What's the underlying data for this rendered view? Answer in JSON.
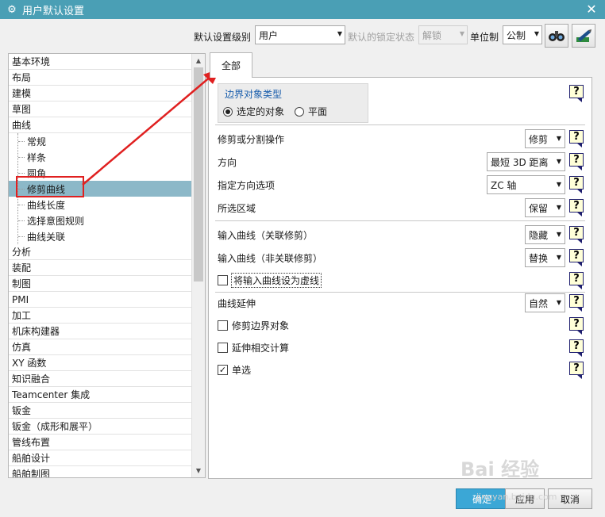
{
  "window": {
    "title": "用户默认设置",
    "close_glyph": "✕",
    "gear_glyph": "⚙"
  },
  "toolbar": {
    "level_label": "默认设置级别",
    "level_value": "用户",
    "lock_label": "默认的锁定状态",
    "lock_value": "解锁",
    "unit_label": "单位制",
    "unit_value": "公制",
    "icons": [
      "find-default-icon",
      "manage-settings-icon"
    ]
  },
  "tree": {
    "items": [
      {
        "label": "基本环境",
        "level": 0
      },
      {
        "label": "布局",
        "level": 0
      },
      {
        "label": "建模",
        "level": 0
      },
      {
        "label": "草图",
        "level": 0
      },
      {
        "label": "曲线",
        "level": 0
      },
      {
        "label": "常规",
        "level": 1
      },
      {
        "label": "样条",
        "level": 1
      },
      {
        "label": "圆角",
        "level": 1
      },
      {
        "label": "修剪曲线",
        "level": 1,
        "selected": true
      },
      {
        "label": "曲线长度",
        "level": 1
      },
      {
        "label": "选择意图规则",
        "level": 1
      },
      {
        "label": "曲线关联",
        "level": 1
      },
      {
        "label": "分析",
        "level": 0
      },
      {
        "label": "装配",
        "level": 0
      },
      {
        "label": "制图",
        "level": 0
      },
      {
        "label": "PMI",
        "level": 0
      },
      {
        "label": "加工",
        "level": 0
      },
      {
        "label": "机床构建器",
        "level": 0
      },
      {
        "label": "仿真",
        "level": 0
      },
      {
        "label": "XY 函数",
        "level": 0
      },
      {
        "label": "知识融合",
        "level": 0
      },
      {
        "label": "Teamcenter 集成",
        "level": 0
      },
      {
        "label": "钣金",
        "level": 0
      },
      {
        "label": "钣金（成形和展平）",
        "level": 0
      },
      {
        "label": "管线布置",
        "level": 0
      },
      {
        "label": "船舶设计",
        "level": 0
      },
      {
        "label": "船舶制图",
        "level": 0
      }
    ]
  },
  "tabs": [
    {
      "label": "全部"
    }
  ],
  "boundary_group": {
    "title": "边界对象类型",
    "options": [
      {
        "label": "选定的对象",
        "checked": true
      },
      {
        "label": "平面",
        "checked": false
      }
    ]
  },
  "settings": {
    "trim_or_split": {
      "label": "修剪或分割操作",
      "value": "修剪"
    },
    "direction": {
      "label": "方向",
      "value": "最短 3D 距离"
    },
    "direction_option": {
      "label": "指定方向选项",
      "value": "ZC 轴"
    },
    "region": {
      "label": "所选区域",
      "value": "保留"
    },
    "input_assoc": {
      "label": "输入曲线（关联修剪）",
      "value": "隐藏"
    },
    "input_nonassoc": {
      "label": "输入曲线（非关联修剪）",
      "value": "替换"
    },
    "dashed_input": {
      "label": "将输入曲线设为虚线",
      "checked": false
    },
    "extension": {
      "label": "曲线延伸",
      "value": "自然"
    },
    "trim_boundary": {
      "label": "修剪边界对象",
      "checked": false
    },
    "extend_intersect": {
      "label": "延伸相交计算",
      "checked": false
    },
    "single": {
      "label": "单选",
      "checked": true
    }
  },
  "help_glyph": "?",
  "footer": {
    "ok": "确定",
    "apply": "应用",
    "cancel": "取消"
  },
  "watermark": {
    "text": "Bai 经验",
    "sub": "jingyan.baidu.com"
  },
  "annotation_color": "#e02020"
}
